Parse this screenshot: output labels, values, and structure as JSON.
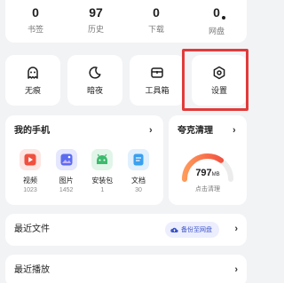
{
  "stats": [
    {
      "value": "0",
      "label": "书签"
    },
    {
      "value": "97",
      "label": "历史"
    },
    {
      "value": "0",
      "label": "下载"
    },
    {
      "value": "0",
      "label": "网盘"
    }
  ],
  "quick_tiles": [
    {
      "label": "无痕",
      "icon": "ghost-icon"
    },
    {
      "label": "暗夜",
      "icon": "moon-icon"
    },
    {
      "label": "工具箱",
      "icon": "toolbox-icon"
    },
    {
      "label": "设置",
      "icon": "gear-icon"
    }
  ],
  "my_phone": {
    "title": "我的手机",
    "items": [
      {
        "label": "视频",
        "count": "1023",
        "icon": "video-icon",
        "color": "#f0513f"
      },
      {
        "label": "图片",
        "count": "1452",
        "icon": "image-icon",
        "color": "#5b6cf0"
      },
      {
        "label": "安装包",
        "count": "1",
        "icon": "android-icon",
        "color": "#3dbb6d"
      },
      {
        "label": "文档",
        "count": "30",
        "icon": "document-icon",
        "color": "#3aa0f0"
      }
    ]
  },
  "cleanup": {
    "title": "夸克清理",
    "value": "797",
    "unit": "MB",
    "action": "点击清理",
    "gauge_fraction": 0.7
  },
  "recent_files": {
    "title": "最近文件",
    "backup_label": "备份至网盘"
  },
  "recent_play": {
    "title": "最近播放"
  },
  "colors": {
    "highlight": "#e23a3a",
    "gauge_start": "#ff9a5a",
    "gauge_end": "#f0413a",
    "backup_text": "#3a53c9"
  },
  "chevron": "›"
}
